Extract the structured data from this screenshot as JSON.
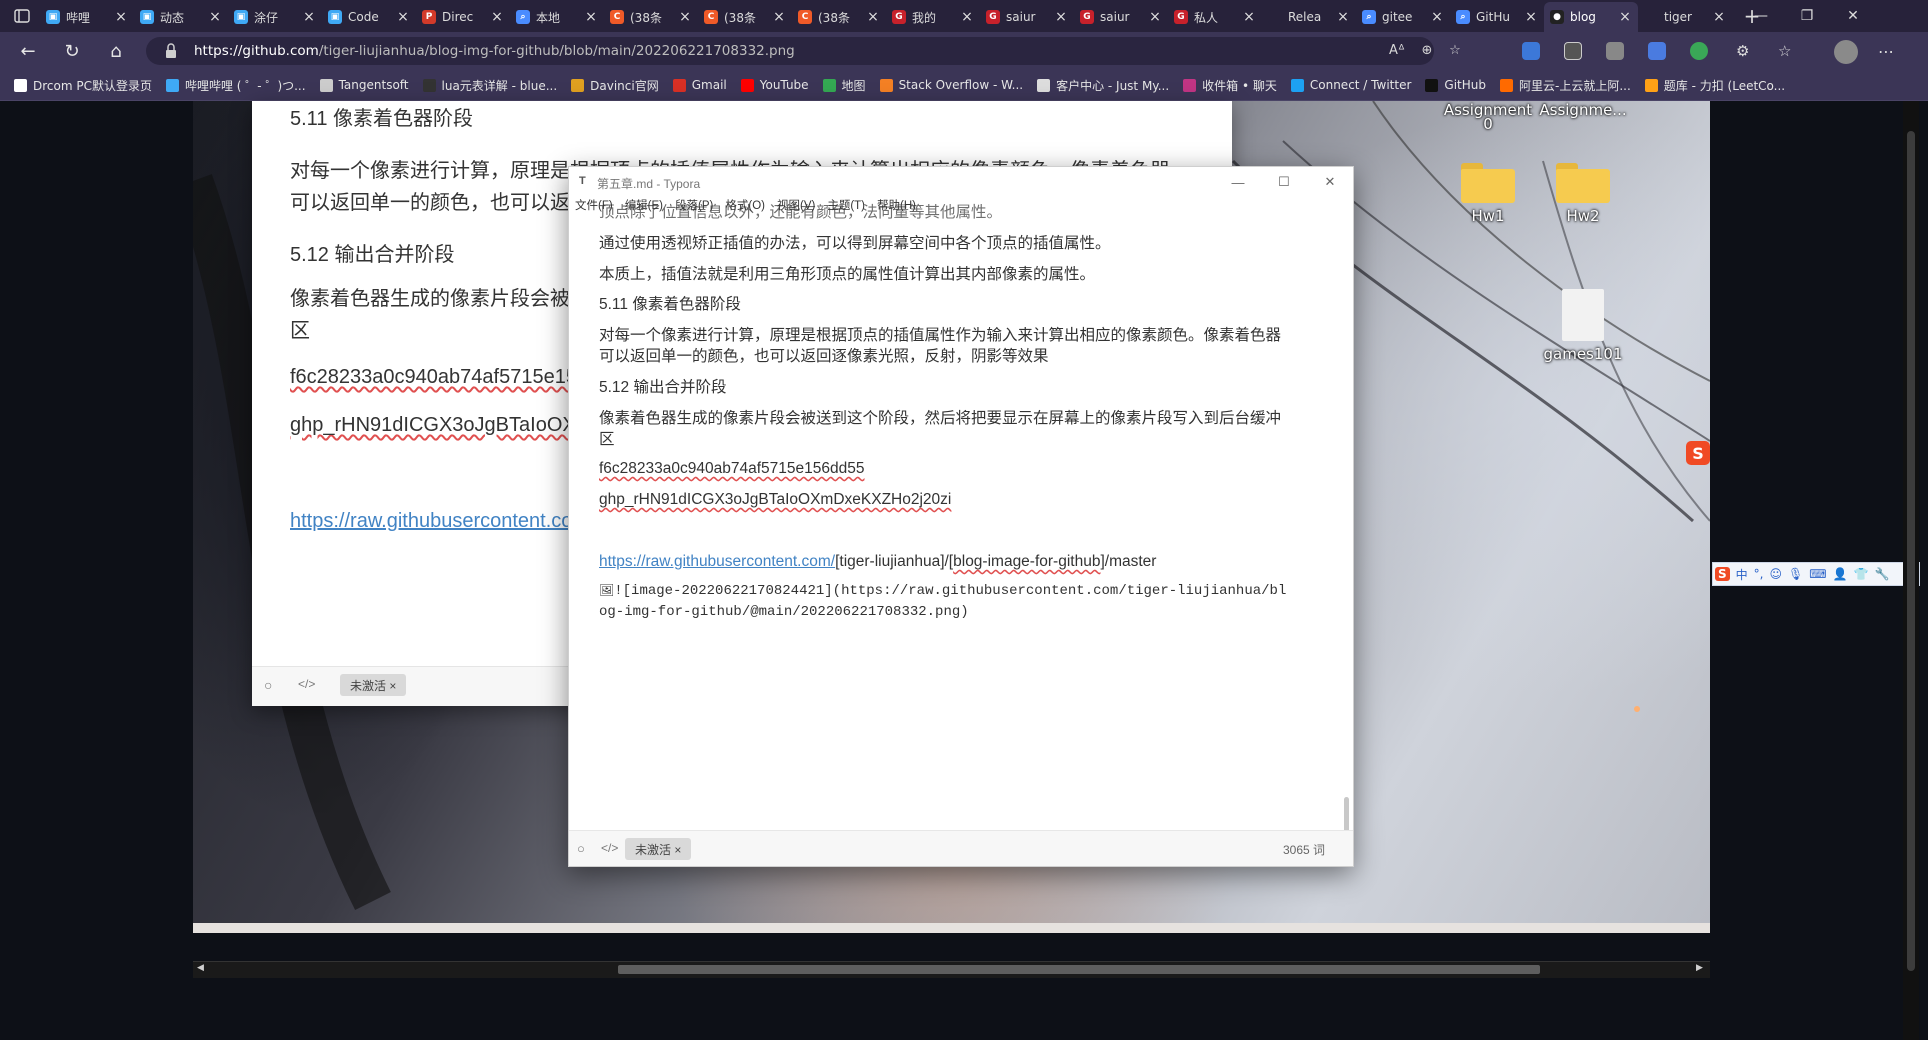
{
  "tabs": [
    {
      "label": "哔哩",
      "color": "#3fa9f5",
      "glyph": "▣",
      "active": false
    },
    {
      "label": "动态",
      "color": "#3fa9f5",
      "glyph": "▣",
      "active": false
    },
    {
      "label": "涂仔",
      "color": "#3fa9f5",
      "glyph": "▣",
      "active": false
    },
    {
      "label": "Code",
      "color": "#3fa9f5",
      "glyph": "▣",
      "active": false
    },
    {
      "label": "Direc",
      "color": "#d23a2a",
      "glyph": "P",
      "active": false
    },
    {
      "label": "本地",
      "color": "#4a8cff",
      "glyph": "⌕",
      "active": false
    },
    {
      "label": "(38条",
      "color": "#f05a28",
      "glyph": "C",
      "active": false
    },
    {
      "label": "(38条",
      "color": "#f05a28",
      "glyph": "C",
      "active": false
    },
    {
      "label": "(38条",
      "color": "#f05a28",
      "glyph": "C",
      "active": false
    },
    {
      "label": "我的",
      "color": "#c7212b",
      "glyph": "G",
      "active": false
    },
    {
      "label": "saiur",
      "color": "#c7212b",
      "glyph": "G",
      "active": false
    },
    {
      "label": "saiur",
      "color": "#c7212b",
      "glyph": "G",
      "active": false
    },
    {
      "label": "私人",
      "color": "#c7212b",
      "glyph": "G",
      "active": false
    },
    {
      "label": "Relea",
      "color": "#27223a",
      "glyph": "",
      "active": false
    },
    {
      "label": "gitee",
      "color": "#4a8cff",
      "glyph": "⌕",
      "active": false
    },
    {
      "label": "GitHu",
      "color": "#4a8cff",
      "glyph": "⌕",
      "active": false
    },
    {
      "label": "blog",
      "color": "#222222",
      "glyph": "●",
      "active": true
    },
    {
      "label": "tiger",
      "color": "#27223a",
      "glyph": "",
      "active": false
    }
  ],
  "address": {
    "host": "https://github.com",
    "path": "/tiger-liujianhua/blog-img-for-github/blob/main/202206221708332.png"
  },
  "bookmarks": [
    {
      "label": "Drcom PC默认登录页",
      "color": "#ffffff"
    },
    {
      "label": "哔哩哔哩 ( ゜- ゜)つ...",
      "color": "#3fa9f5"
    },
    {
      "label": "Tangentsoft",
      "color": "#cccccc"
    },
    {
      "label": "lua元表详解 - blue...",
      "color": "#333333"
    },
    {
      "label": "Davinci官网",
      "color": "#e0a020"
    },
    {
      "label": "Gmail",
      "color": "#d93025"
    },
    {
      "label": "YouTube",
      "color": "#ff0000"
    },
    {
      "label": "地图",
      "color": "#34a853"
    },
    {
      "label": "Stack Overflow - W...",
      "color": "#f48024"
    },
    {
      "label": "客户中心 - Just My...",
      "color": "#dddddd"
    },
    {
      "label": "收件箱 • 聊天",
      "color": "#c13584"
    },
    {
      "label": "Connect / Twitter",
      "color": "#1da1f2"
    },
    {
      "label": "GitHub",
      "color": "#111111"
    },
    {
      "label": "阿里云-上云就上阿...",
      "color": "#ff6a00"
    },
    {
      "label": "题库 - 力扣 (LeetCo...",
      "color": "#ffa116"
    }
  ],
  "desktop": {
    "assign1": "Assignment",
    "assign1b": "0",
    "assign2": "Assignme...",
    "hw1": "Hw1",
    "hw2": "Hw2",
    "games": "games101"
  },
  "bg_doc": {
    "h511": "5.11 像素着色器阶段",
    "p1a": "对每一个像素进行计算，原理是根据顶点的插值属性作为输入来计算出相应的像素颜色。像素着色器",
    "p1b": "可以返回单一的颜色，也可以返回逐像素光照，反射，阴影等效果",
    "h512": "5.12 输出合并阶段",
    "p2a": "像素着色器生成的像素片段会被送到这个阶段，然后将把要显示在屏幕上的像素片段写入到后台缓冲",
    "p2b": "区",
    "hash": "f6c28233a0c940ab74af5715e156dd55",
    "token": "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",
    "link": "https://raw.githubusercontent.com/",
    "badge": "未激活 ×"
  },
  "typora": {
    "title": "第五章.md - Typora",
    "menus": [
      "文件(F)",
      "编辑(E)",
      "段落(P)",
      "格式(O)",
      "视图(V)",
      "主题(T)",
      "帮助(H)"
    ],
    "line0": "顶点除了位置信息以外，还能有颜色，法向量等其他属性。",
    "line1": "通过使用透视矫正插值的办法，可以得到屏幕空间中各个顶点的插值属性。",
    "line2": "本质上，插值法就是利用三角形顶点的属性值计算出其内部像素的属性。",
    "h511": "5.11 像素着色器阶段",
    "p1a": "对每一个像素进行计算，原理是根据顶点的插值属性作为输入来计算出相应的像素颜色。像素着色器",
    "p1b": "可以返回单一的颜色，也可以返回逐像素光照，反射，阴影等效果",
    "h512": "5.12 输出合并阶段",
    "p2a": "像素着色器生成的像素片段会被送到这个阶段，然后将把要显示在屏幕上的像素片段写入到后台缓冲",
    "p2b": "区",
    "hash": "f6c28233a0c940ab74af5715e156dd55",
    "token": "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",
    "raw_link": "https://raw.githubusercontent.com/",
    "raw_rest1": "[tiger-liujianhua]/[",
    "raw_blog": "blog-image-for-github",
    "raw_rest2": "]/master",
    "img_md_a": "![image-20220622170824421](https://raw.githubusercontent.com/tiger-liujianhua/bl",
    "img_md_b": "og-img-for-github/@main/202206221708332.png)",
    "badge": "未激活 ×",
    "wordcount": "3065 词"
  },
  "ime": [
    "中",
    "°,",
    "☺",
    "🎙",
    "⌨",
    "👤",
    "👕",
    "🔧"
  ]
}
